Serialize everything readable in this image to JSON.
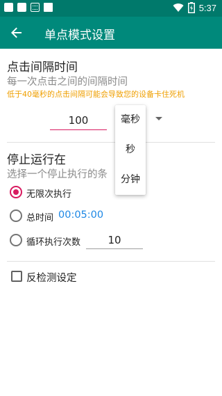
{
  "status_bar": {
    "time": "5:37",
    "left_icons": [
      "notification-icon",
      "notification-icon",
      "keyboard-icon",
      "book-icon"
    ],
    "right_icons": [
      "wifi-icon",
      "battery-icon"
    ]
  },
  "app_bar": {
    "title": "单点模式设置",
    "back_icon": "arrow-back-icon"
  },
  "click_interval": {
    "title": "点击间隔时间",
    "subtitle": "每一次点击之间的间隔时间",
    "warning": "低于40毫秒的点击间隔可能会导致您的设备卡住死机",
    "value": "100",
    "unit_options": [
      "毫秒",
      "秒",
      "分钟"
    ]
  },
  "stop_running": {
    "title": "停止运行在",
    "subtitle": "选择一个停止执行的条",
    "options": [
      {
        "label": "无限次执行",
        "selected": true
      },
      {
        "label": "总时间",
        "selected": false,
        "value": "00:05:00"
      },
      {
        "label": "循环执行次数",
        "selected": false,
        "value": "10"
      }
    ]
  },
  "anti_detect": {
    "label": "反检测设定",
    "checked": false
  },
  "colors": {
    "primary": "#00897b",
    "primary_dark": "#00796b",
    "accent": "#d81b60",
    "warning": "#ef9f00",
    "link_blue": "#1e88e5"
  }
}
